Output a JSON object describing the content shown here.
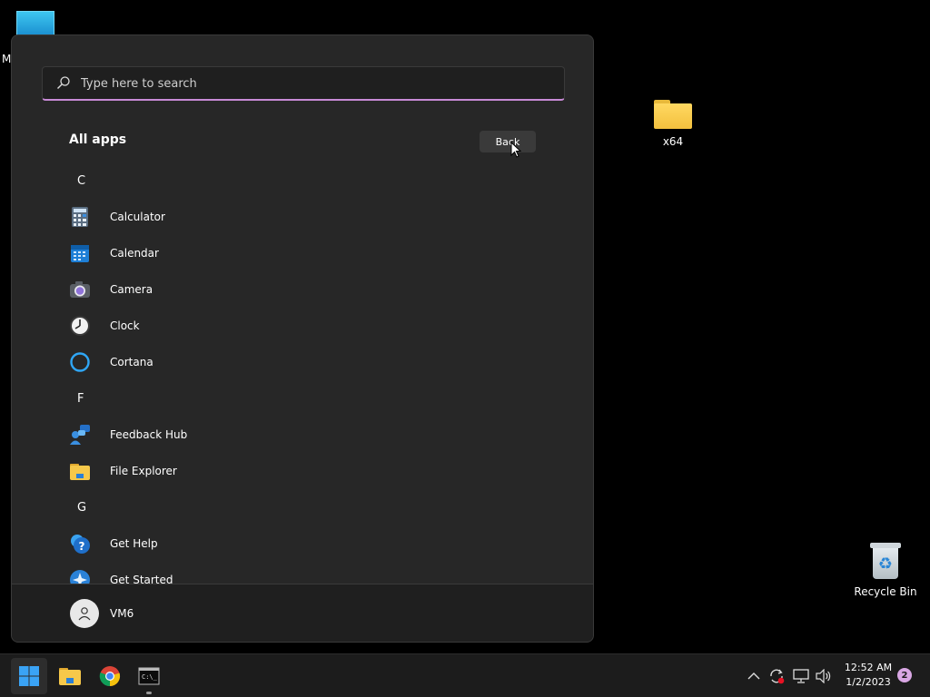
{
  "desktop": {
    "top_letter": "M",
    "items": [
      {
        "label": "x64",
        "icon": "folder-icon"
      },
      {
        "label": "Recycle Bin",
        "icon": "recycle-bin-icon"
      }
    ]
  },
  "start_menu": {
    "search": {
      "placeholder": "Type here to search",
      "value": ""
    },
    "title": "All apps",
    "back_label": "Back",
    "list": [
      {
        "type": "letter",
        "text": "C"
      },
      {
        "type": "app",
        "label": "Calculator",
        "icon": "calculator-icon"
      },
      {
        "type": "app",
        "label": "Calendar",
        "icon": "calendar-icon"
      },
      {
        "type": "app",
        "label": "Camera",
        "icon": "camera-icon"
      },
      {
        "type": "app",
        "label": "Clock",
        "icon": "clock-icon"
      },
      {
        "type": "app",
        "label": "Cortana",
        "icon": "cortana-icon"
      },
      {
        "type": "letter",
        "text": "F"
      },
      {
        "type": "app",
        "label": "Feedback Hub",
        "icon": "feedback-hub-icon"
      },
      {
        "type": "app",
        "label": "File Explorer",
        "icon": "file-explorer-icon"
      },
      {
        "type": "letter",
        "text": "G"
      },
      {
        "type": "app",
        "label": "Get Help",
        "icon": "get-help-icon"
      },
      {
        "type": "app",
        "label": "Get Started",
        "icon": "get-started-icon"
      }
    ],
    "user": {
      "name": "VM6"
    }
  },
  "taskbar": {
    "apps": [
      "start-icon",
      "file-explorer-icon",
      "chrome-icon",
      "terminal-icon"
    ],
    "clock": {
      "time": "12:52 AM",
      "date": "1/2/2023"
    },
    "notification_count": "2"
  },
  "colors": {
    "accent": "#c88ad6",
    "menu_bg": "#272727",
    "taskbar_bg": "#1c1c1c"
  }
}
